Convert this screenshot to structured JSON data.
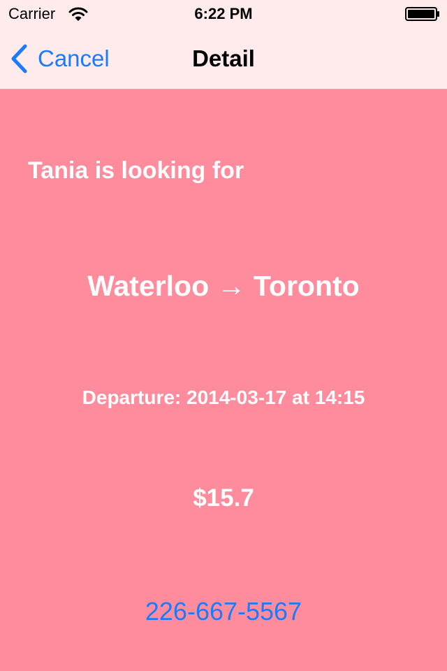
{
  "status_bar": {
    "carrier": "Carrier",
    "time": "6:22 PM",
    "wifi_icon": "wifi-icon",
    "battery_icon": "battery-icon"
  },
  "nav_bar": {
    "back_label": "Cancel",
    "back_icon": "chevron-left-icon",
    "title": "Detail"
  },
  "detail": {
    "looking_for": "Tania is looking for",
    "route": "Waterloo → Toronto",
    "departure": "Departure: 2014-03-17 at 14:15",
    "price": "$15.7",
    "phone": "226-667-5567"
  },
  "colors": {
    "background": "#ff8c9d",
    "bar_background": "#ffebec",
    "accent": "#1a7bff",
    "text": "#ffffff"
  }
}
